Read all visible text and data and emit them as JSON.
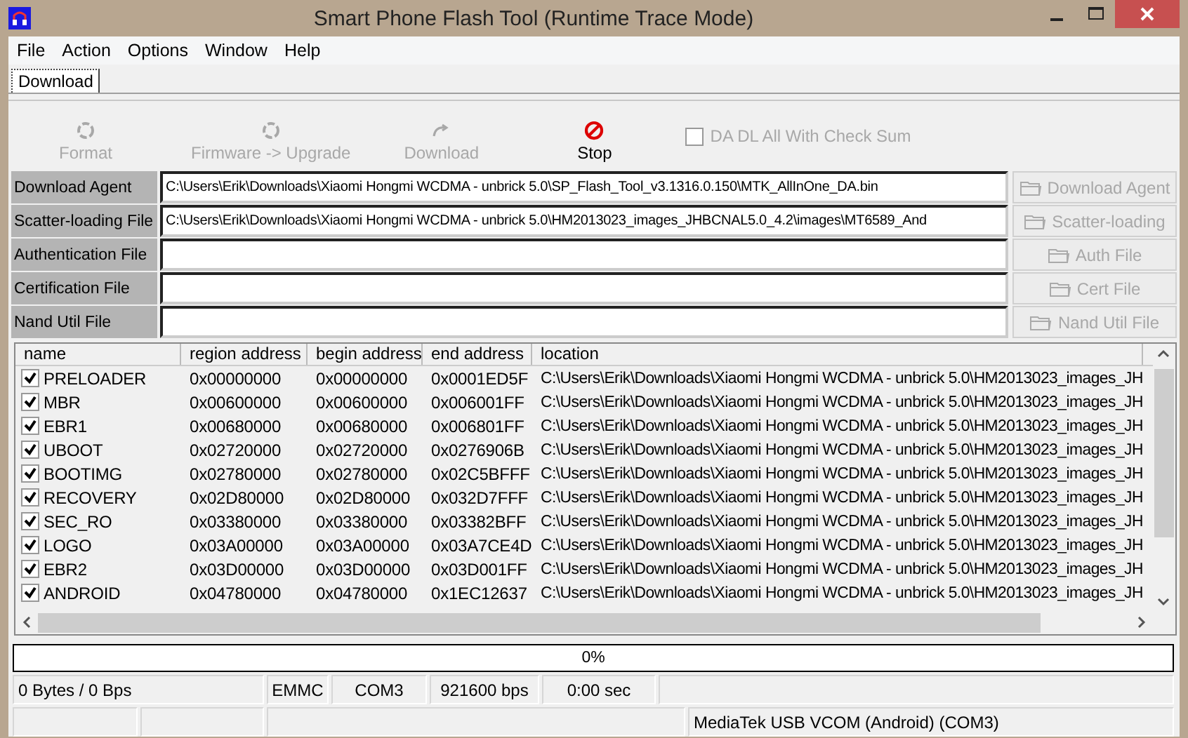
{
  "window": {
    "title": "Smart Phone Flash Tool (Runtime Trace Mode)"
  },
  "menu": [
    "File",
    "Action",
    "Options",
    "Window",
    "Help"
  ],
  "tabs": [
    {
      "label": "Download",
      "selected": true
    }
  ],
  "toolbar": [
    {
      "label": "Format",
      "kind": "format",
      "disabled": true
    },
    {
      "label": "Firmware -> Upgrade",
      "kind": "upgrade",
      "disabled": true
    },
    {
      "label": "Download",
      "kind": "download",
      "disabled": true
    },
    {
      "label": "Stop",
      "kind": "stop",
      "disabled": false
    }
  ],
  "checksum": {
    "label": "DA DL All With Check Sum",
    "checked": false,
    "disabled": true
  },
  "files": [
    {
      "label": "Download Agent",
      "value": "C:\\Users\\Erik\\Downloads\\Xiaomi Hongmi WCDMA - unbrick 5.0\\SP_Flash_Tool_v3.1316.0.150\\MTK_AllInOne_DA.bin",
      "button": "Download Agent"
    },
    {
      "label": "Scatter-loading File",
      "value": "C:\\Users\\Erik\\Downloads\\Xiaomi Hongmi WCDMA - unbrick 5.0\\HM2013023_images_JHBCNAL5.0_4.2\\images\\MT6589_And",
      "button": "Scatter-loading"
    },
    {
      "label": "Authentication File",
      "button": "Auth File"
    },
    {
      "label": "Certification File",
      "button": "Cert File"
    },
    {
      "label": "Nand Util File",
      "button": "Nand Util File"
    }
  ],
  "table": {
    "columns": [
      "name",
      "region address",
      "begin address",
      "end address",
      "location"
    ],
    "rows": [
      {
        "name": "PRELOADER",
        "checked": true,
        "region": "0x00000000",
        "begin": "0x00000000",
        "end": "0x0001ED5F",
        "location": "C:\\Users\\Erik\\Downloads\\Xiaomi Hongmi WCDMA - unbrick 5.0\\HM2013023_images_JH"
      },
      {
        "name": "MBR",
        "checked": true,
        "region": "0x00600000",
        "begin": "0x00600000",
        "end": "0x006001FF",
        "location": "C:\\Users\\Erik\\Downloads\\Xiaomi Hongmi WCDMA - unbrick 5.0\\HM2013023_images_JH"
      },
      {
        "name": "EBR1",
        "checked": true,
        "region": "0x00680000",
        "begin": "0x00680000",
        "end": "0x006801FF",
        "location": "C:\\Users\\Erik\\Downloads\\Xiaomi Hongmi WCDMA - unbrick 5.0\\HM2013023_images_JH"
      },
      {
        "name": "UBOOT",
        "checked": true,
        "region": "0x02720000",
        "begin": "0x02720000",
        "end": "0x0276906B",
        "location": "C:\\Users\\Erik\\Downloads\\Xiaomi Hongmi WCDMA - unbrick 5.0\\HM2013023_images_JH"
      },
      {
        "name": "BOOTIMG",
        "checked": true,
        "region": "0x02780000",
        "begin": "0x02780000",
        "end": "0x02C5BFFF",
        "location": "C:\\Users\\Erik\\Downloads\\Xiaomi Hongmi WCDMA - unbrick 5.0\\HM2013023_images_JH"
      },
      {
        "name": "RECOVERY",
        "checked": true,
        "region": "0x02D80000",
        "begin": "0x02D80000",
        "end": "0x032D7FFF",
        "location": "C:\\Users\\Erik\\Downloads\\Xiaomi Hongmi WCDMA - unbrick 5.0\\HM2013023_images_JH"
      },
      {
        "name": "SEC_RO",
        "checked": true,
        "region": "0x03380000",
        "begin": "0x03380000",
        "end": "0x03382BFF",
        "location": "C:\\Users\\Erik\\Downloads\\Xiaomi Hongmi WCDMA - unbrick 5.0\\HM2013023_images_JH"
      },
      {
        "name": "LOGO",
        "checked": true,
        "region": "0x03A00000",
        "begin": "0x03A00000",
        "end": "0x03A7CE4D",
        "location": "C:\\Users\\Erik\\Downloads\\Xiaomi Hongmi WCDMA - unbrick 5.0\\HM2013023_images_JH"
      },
      {
        "name": "EBR2",
        "checked": true,
        "region": "0x03D00000",
        "begin": "0x03D00000",
        "end": "0x03D001FF",
        "location": "C:\\Users\\Erik\\Downloads\\Xiaomi Hongmi WCDMA - unbrick 5.0\\HM2013023_images_JH"
      },
      {
        "name": "ANDROID",
        "checked": true,
        "region": "0x04780000",
        "begin": "0x04780000",
        "end": "0x1EC12637",
        "location": "C:\\Users\\Erik\\Downloads\\Xiaomi Hongmi WCDMA - unbrick 5.0\\HM2013023_images_JH"
      }
    ]
  },
  "progress": {
    "label": "0%",
    "level": 0
  },
  "status_bar": {
    "row_1": [
      "0 Bytes / 0 Bps",
      "EMMC",
      "COM3",
      "921600 bps",
      "0:00 sec"
    ],
    "row_2": [
      "MediaTek USB VCOM (Android) (COM3)"
    ]
  }
}
